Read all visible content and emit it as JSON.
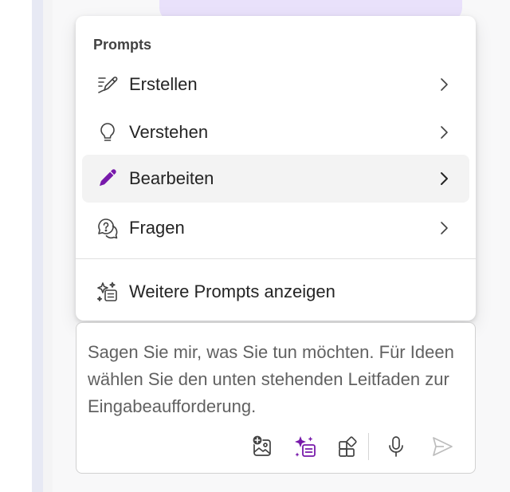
{
  "menu": {
    "header": "Prompts",
    "items": [
      {
        "label": "Erstellen",
        "icon": "pen-lines-icon"
      },
      {
        "label": "Verstehen",
        "icon": "lightbulb-icon"
      },
      {
        "label": "Bearbeiten",
        "icon": "pencil-icon",
        "selected": true
      },
      {
        "label": "Fragen",
        "icon": "question-bubble-icon"
      }
    ],
    "more": {
      "label": "Weitere Prompts anzeigen",
      "icon": "sparkle-list-icon"
    }
  },
  "composer": {
    "placeholder": "Sagen Sie mir, was Sie tun möchten. Für Ideen wählen Sie den unten stehenden Leitfaden zur Eingabeaufforderung.",
    "toolbar": [
      {
        "name": "add-image",
        "icon": "image-add-icon"
      },
      {
        "name": "prompts",
        "icon": "sparkle-prompts-icon"
      },
      {
        "name": "plugins",
        "icon": "apps-add-icon"
      },
      {
        "name": "microphone",
        "icon": "microphone-icon"
      },
      {
        "name": "send",
        "icon": "send-icon"
      }
    ]
  },
  "colors": {
    "accent": "#7719aa",
    "text": "#242424",
    "muted": "#616161",
    "disabled": "#bdbdbd",
    "selected_bg": "#f3f3f3",
    "user_bubble": "#e9e1fb"
  }
}
